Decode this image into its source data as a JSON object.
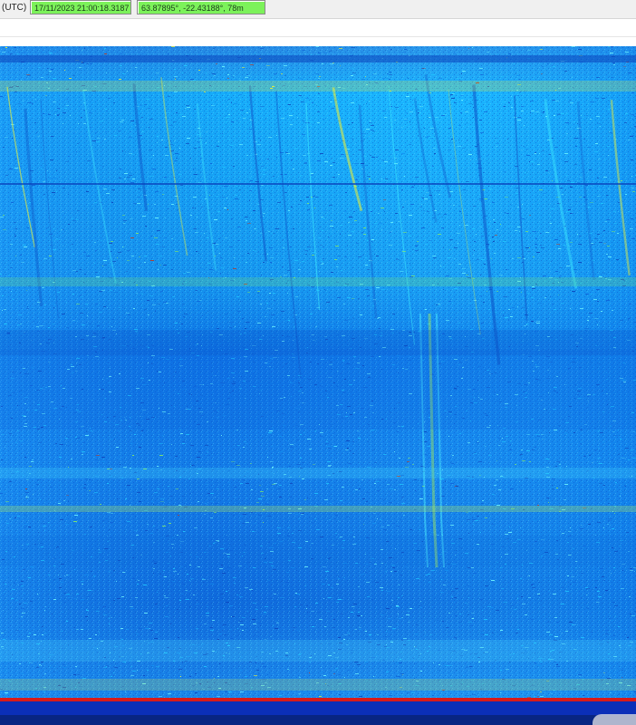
{
  "header": {
    "timezone_label": "(UTC)",
    "datetime_value": "17/11/2023 21:00:18.3187",
    "position_value": "63.87895°, -22.43188°, 78m"
  },
  "colors": {
    "field_background": "#7cf25a",
    "waterfall_background": "#1f6fd1",
    "waterfall_strong": "#28d8ff",
    "waterfall_warm": "#e7f03b",
    "waterfall_hot": "#c13319",
    "bottom_band_blue": "#0b2fb8",
    "bottom_band_red": "#d81b1b"
  },
  "waterfall": {
    "kind": "spectrogram",
    "palette": [
      "deep-blue",
      "blue",
      "cyan",
      "green",
      "yellow",
      "red"
    ]
  }
}
